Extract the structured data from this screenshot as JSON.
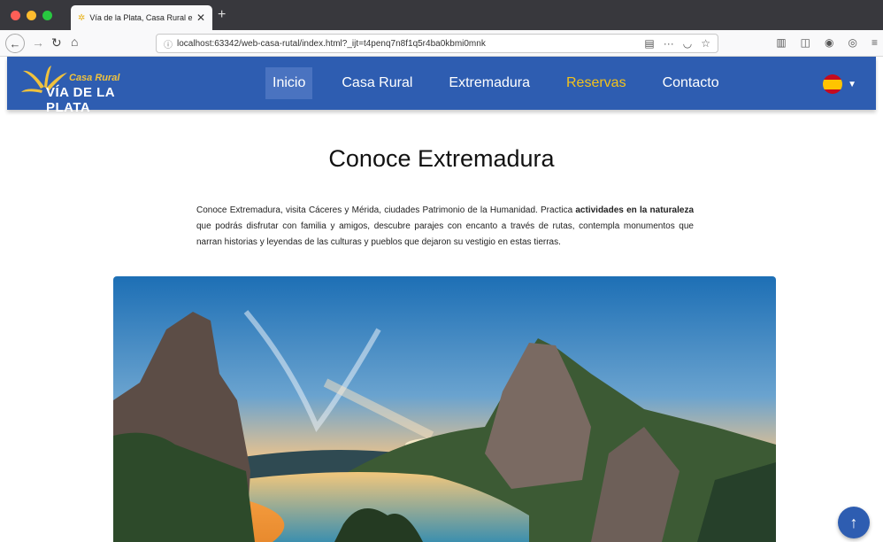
{
  "browser": {
    "tab_title": "Vía de la Plata, Casa Rural en E",
    "tab_close": "✕",
    "new_tab": "+",
    "url": "localhost:63342/web-casa-rutal/index.html?_ijt=t4penq7n8f1q5r4ba0kbmi0mnk",
    "icons": [
      "back-icon",
      "forward-icon",
      "reload-icon",
      "home-icon",
      "info-icon",
      "reader-icon",
      "more-icon",
      "pocket-icon",
      "bookmark-icon",
      "library-icon",
      "sidebar-icon",
      "extension-icon",
      "account-icon",
      "menu-icon"
    ]
  },
  "header": {
    "logo_small": "Casa Rural",
    "logo_big": "VÍA DE LA PLATA",
    "nav": [
      {
        "label": "Inicio"
      },
      {
        "label": "Casa Rural"
      },
      {
        "label": "Extremadura"
      },
      {
        "label": "Reservas"
      },
      {
        "label": "Contacto"
      }
    ],
    "brand_color": "#2e5db1",
    "accent_color": "#f3c21c"
  },
  "main": {
    "title": "Conoce Extremadura",
    "intro_part1": "Conoce Extremadura, visita Cáceres y Mérida, ciudades Patrimonio de la Humanidad. Practica ",
    "intro_bold": "actividades en la naturaleza",
    "intro_part2": " que podrás disfrutar con familia y amigos, descubre parajes con encanto a través de rutas, contempla monumentos que narran historias y leyendas de las culturas y pueblos que dejaron su vestigio en estas tierras."
  },
  "scroll_top_icon": "arrow-up-icon"
}
